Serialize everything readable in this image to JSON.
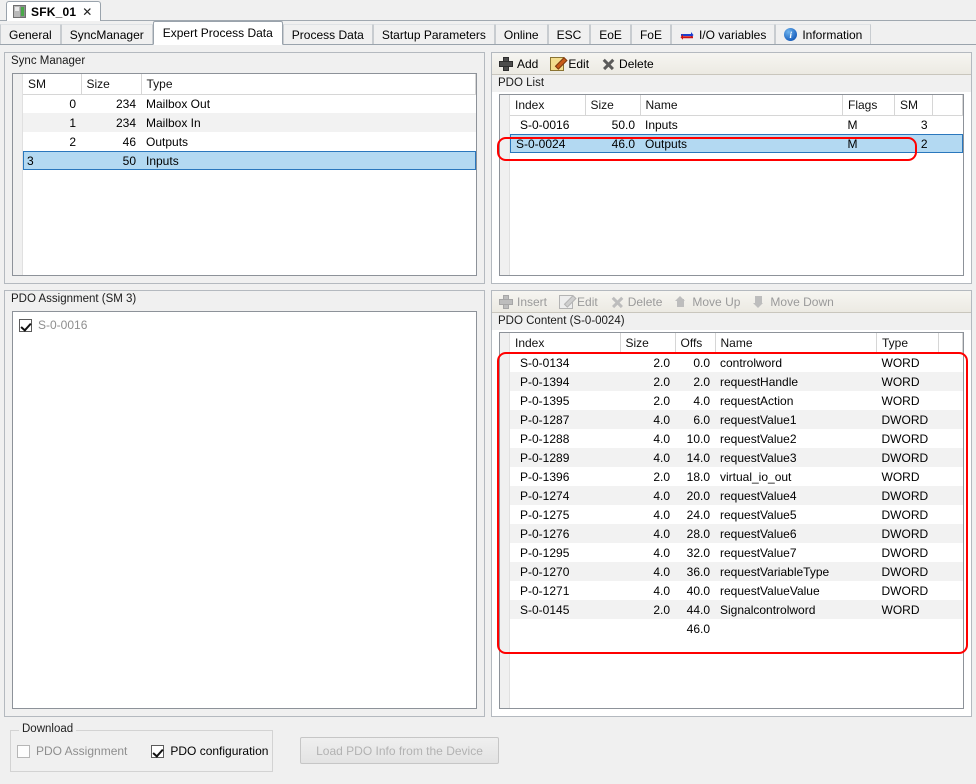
{
  "document_tab": {
    "title": "SFK_01",
    "close_label": "✕",
    "icon": "device-icon"
  },
  "tabs": [
    {
      "label": "General",
      "active": false
    },
    {
      "label": "SyncManager",
      "active": false
    },
    {
      "label": "Expert Process Data",
      "active": true
    },
    {
      "label": "Process Data",
      "active": false
    },
    {
      "label": "Startup Parameters",
      "active": false
    },
    {
      "label": "Online",
      "active": false
    },
    {
      "label": "ESC",
      "active": false
    },
    {
      "label": "EoE",
      "active": false
    },
    {
      "label": "FoE",
      "active": false
    },
    {
      "label": "I/O variables",
      "active": false,
      "icon": "io-arrows-icon"
    },
    {
      "label": "Information",
      "active": false,
      "icon": "info-icon"
    }
  ],
  "sync_manager": {
    "title": "Sync Manager",
    "columns": [
      "SM",
      "Size",
      "Type"
    ],
    "rows": [
      {
        "sm": "0",
        "size": "234",
        "type": "Mailbox Out",
        "selected": false
      },
      {
        "sm": "1",
        "size": "234",
        "type": "Mailbox In",
        "selected": false
      },
      {
        "sm": "2",
        "size": "46",
        "type": "Outputs",
        "selected": false
      },
      {
        "sm": "3",
        "size": "50",
        "type": "Inputs",
        "selected": true
      }
    ]
  },
  "pdo_assignment": {
    "title": "PDO Assignment (SM 3)",
    "items": [
      {
        "label": "S-0-0016",
        "checked": true,
        "disabled": true
      }
    ]
  },
  "pdo_list": {
    "toolbar": [
      {
        "label": "Add",
        "icon": "plus-icon",
        "disabled": false
      },
      {
        "label": "Edit",
        "icon": "edit-icon",
        "disabled": false
      },
      {
        "label": "Delete",
        "icon": "delete-x-icon",
        "disabled": false
      }
    ],
    "title": "PDO List",
    "columns": [
      "Index",
      "Size",
      "Name",
      "Flags",
      "SM"
    ],
    "rows": [
      {
        "index": "S-0-0016",
        "size": "50.0",
        "name": "Inputs",
        "flags": "M",
        "sm": "3",
        "selected": false
      },
      {
        "index": "S-0-0024",
        "size": "46.0",
        "name": "Outputs",
        "flags": "M",
        "sm": "2",
        "selected": true
      }
    ]
  },
  "pdo_content": {
    "toolbar": [
      {
        "label": "Insert",
        "icon": "plus-icon",
        "disabled": true
      },
      {
        "label": "Edit",
        "icon": "edit-icon",
        "disabled": true
      },
      {
        "label": "Delete",
        "icon": "delete-x-icon",
        "disabled": true
      },
      {
        "label": "Move Up",
        "icon": "arrow-up-icon",
        "disabled": true
      },
      {
        "label": "Move Down",
        "icon": "arrow-down-icon",
        "disabled": true
      }
    ],
    "title": "PDO Content (S-0-0024)",
    "columns": [
      "Index",
      "Size",
      "Offs",
      "Name",
      "Type"
    ],
    "rows": [
      {
        "index": "S-0-0134",
        "size": "2.0",
        "offs": "0.0",
        "name": "controlword",
        "type": "WORD"
      },
      {
        "index": "P-0-1394",
        "size": "2.0",
        "offs": "2.0",
        "name": "requestHandle",
        "type": "WORD"
      },
      {
        "index": "P-0-1395",
        "size": "2.0",
        "offs": "4.0",
        "name": "requestAction",
        "type": "WORD"
      },
      {
        "index": "P-0-1287",
        "size": "4.0",
        "offs": "6.0",
        "name": "requestValue1",
        "type": "DWORD"
      },
      {
        "index": "P-0-1288",
        "size": "4.0",
        "offs": "10.0",
        "name": "requestValue2",
        "type": "DWORD"
      },
      {
        "index": "P-0-1289",
        "size": "4.0",
        "offs": "14.0",
        "name": "requestValue3",
        "type": "DWORD"
      },
      {
        "index": "P-0-1396",
        "size": "2.0",
        "offs": "18.0",
        "name": "virtual_io_out",
        "type": "WORD"
      },
      {
        "index": "P-0-1274",
        "size": "4.0",
        "offs": "20.0",
        "name": "requestValue4",
        "type": "DWORD"
      },
      {
        "index": "P-0-1275",
        "size": "4.0",
        "offs": "24.0",
        "name": "requestValue5",
        "type": "DWORD"
      },
      {
        "index": "P-0-1276",
        "size": "4.0",
        "offs": "28.0",
        "name": "requestValue6",
        "type": "DWORD"
      },
      {
        "index": "P-0-1295",
        "size": "4.0",
        "offs": "32.0",
        "name": "requestValue7",
        "type": "DWORD"
      },
      {
        "index": "P-0-1270",
        "size": "4.0",
        "offs": "36.0",
        "name": "requestVariableType",
        "type": "DWORD"
      },
      {
        "index": "P-0-1271",
        "size": "4.0",
        "offs": "40.0",
        "name": "requestValueValue",
        "type": "DWORD"
      },
      {
        "index": "S-0-0145",
        "size": "2.0",
        "offs": "44.0",
        "name": "Signalcontrolword",
        "type": "WORD"
      },
      {
        "index": "",
        "size": "",
        "offs": "46.0",
        "name": "",
        "type": ""
      }
    ]
  },
  "download": {
    "legend": "Download",
    "pdo_assignment": {
      "label": "PDO Assignment",
      "checked": false,
      "disabled": true
    },
    "pdo_configuration": {
      "label": "PDO configuration",
      "checked": true,
      "disabled": false
    },
    "load_button": {
      "label": "Load PDO Info from the Device",
      "disabled": true
    }
  },
  "annotations": {
    "color": "#ff0000"
  }
}
